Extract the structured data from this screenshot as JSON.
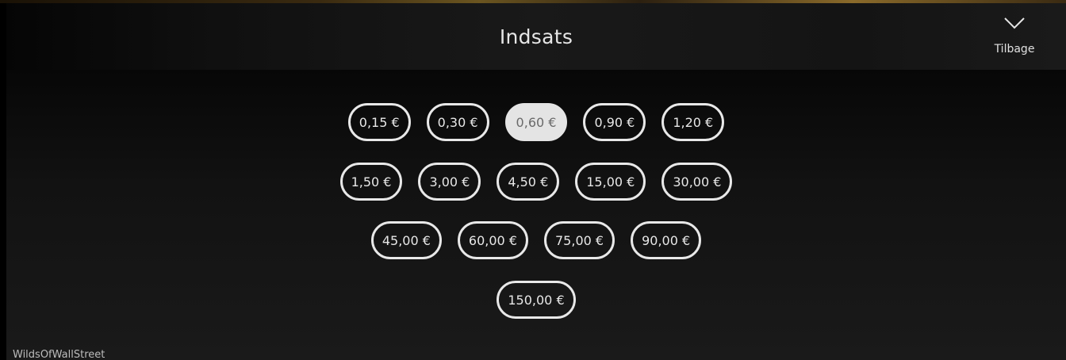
{
  "header": {
    "title": "Indsats",
    "back_label": "Tilbage",
    "back_icon": "chevron-down-icon"
  },
  "bets": {
    "currency": "€",
    "selected": "0,60 €",
    "rows": [
      [
        "0,15 €",
        "0,30 €",
        "0,60 €",
        "0,90 €",
        "1,20 €"
      ],
      [
        "1,50 €",
        "3,00 €",
        "4,50 €",
        "15,00 €",
        "30,00 €"
      ],
      [
        "45,00 €",
        "60,00 €",
        "75,00 €",
        "90,00 €"
      ],
      [
        "150,00 €"
      ]
    ]
  },
  "footer": {
    "game_name": "WildsOfWallStreet"
  },
  "colors": {
    "chip_border": "#e8e8e8",
    "chip_selected_bg": "#e4e4e4",
    "chip_selected_text": "#6a6a6a",
    "background": "#0c0c0c"
  }
}
